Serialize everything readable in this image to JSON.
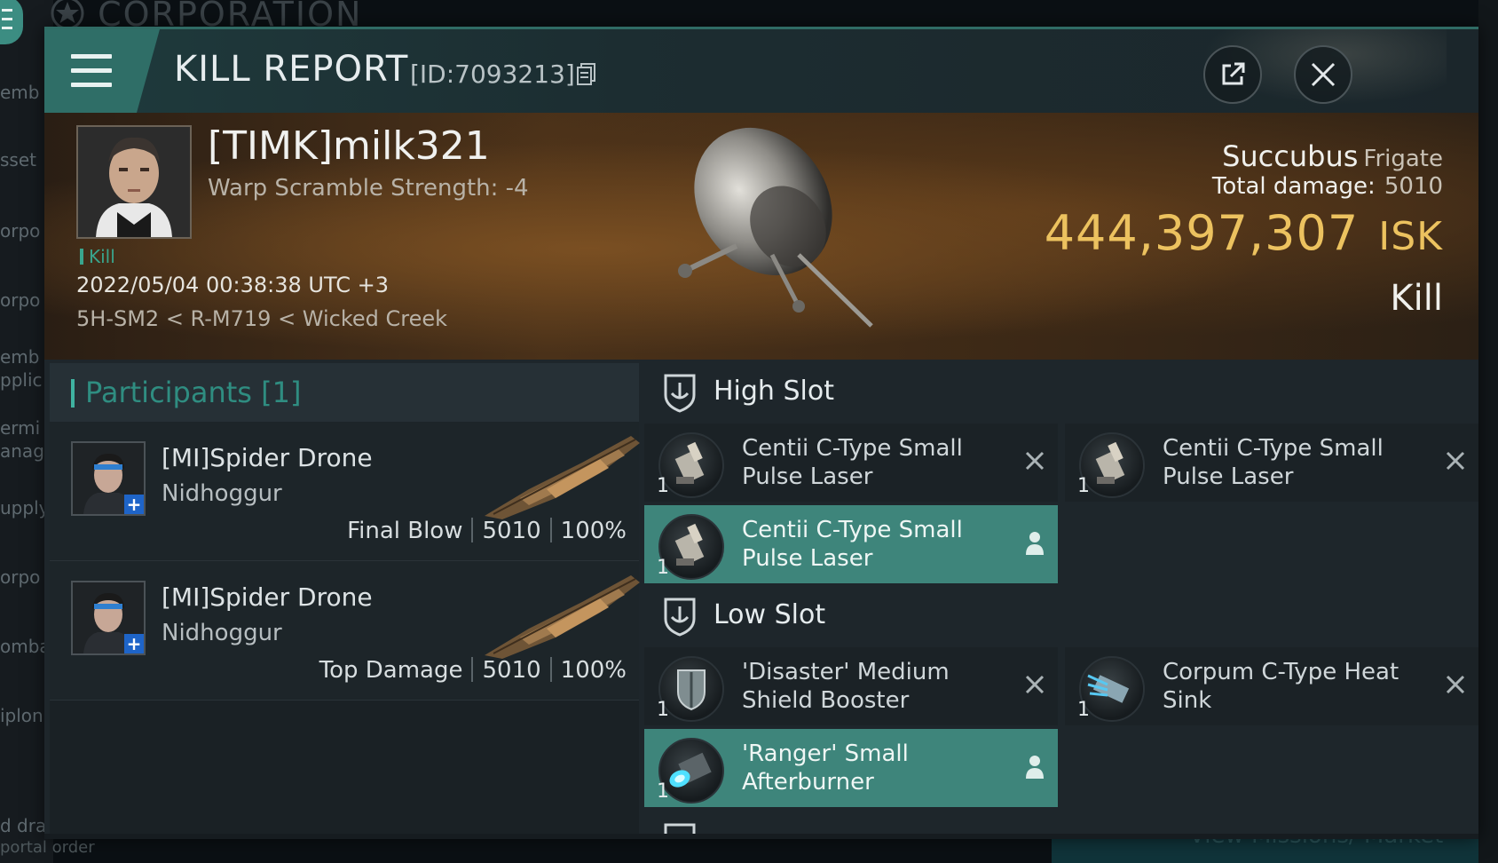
{
  "background": {
    "corporation_header": "CORPORATION",
    "sidebar_fragments": [
      "emb",
      "sset",
      "orpo",
      "orpo",
      "emb",
      "pplic",
      "ermi",
      "anag",
      "upply",
      "orpo",
      "omba",
      "iplon",
      "d drag"
    ],
    "portal_order": "portal order",
    "bottom_link": "View Missions/ Market"
  },
  "window": {
    "title": "KILL REPORT",
    "report_id": "[ID:7093213]",
    "icons": {
      "menu": "hamburger-icon",
      "copy": "copy-icon",
      "share": "share-icon",
      "close": "close-icon"
    }
  },
  "victim": {
    "name": "[TIMK]milk321",
    "detail": "Warp Scramble Strength: -4",
    "tag": "Kill",
    "datetime": "2022/05/04 00:38:38 UTC +3",
    "location": "5H-SM2 < R-M719 < Wicked Creek",
    "ship_name": "Succubus",
    "ship_class": "Frigate",
    "total_damage_label": "Total damage:",
    "total_damage_value": "5010",
    "isk_value": "444,397,307",
    "isk_unit": "ISK",
    "result": "Kill"
  },
  "participants": {
    "title": "Participants [1]",
    "rows": [
      {
        "name": "[MI]Spider Drone",
        "ship": "Nidhoggur",
        "role": "Final Blow",
        "damage": "5010",
        "percent": "100%"
      },
      {
        "name": "[MI]Spider Drone",
        "ship": "Nidhoggur",
        "role": "Top Damage",
        "damage": "5010",
        "percent": "100%"
      }
    ]
  },
  "fitting": {
    "high_slot": {
      "title": "High Slot",
      "items": [
        {
          "qty": "1",
          "name": "Centii C-Type Small Pulse Laser",
          "state": "destroyed"
        },
        {
          "qty": "1",
          "name": "Centii C-Type Small Pulse Laser",
          "state": "destroyed"
        },
        {
          "qty": "1",
          "name": "Centii C-Type Small Pulse Laser",
          "state": "dropped"
        }
      ]
    },
    "low_slot": {
      "title": "Low Slot",
      "items": [
        {
          "qty": "1",
          "name": "'Disaster' Medium Shield Booster",
          "state": "destroyed"
        },
        {
          "qty": "1",
          "name": "Corpum C-Type Heat Sink",
          "state": "destroyed"
        },
        {
          "qty": "1",
          "name": "'Ranger' Small Afterburner",
          "state": "dropped"
        }
      ]
    },
    "colors": {
      "dropped_highlight": "#3e857b",
      "accent": "#3fb3a1",
      "isk": "#ecc25f"
    }
  }
}
